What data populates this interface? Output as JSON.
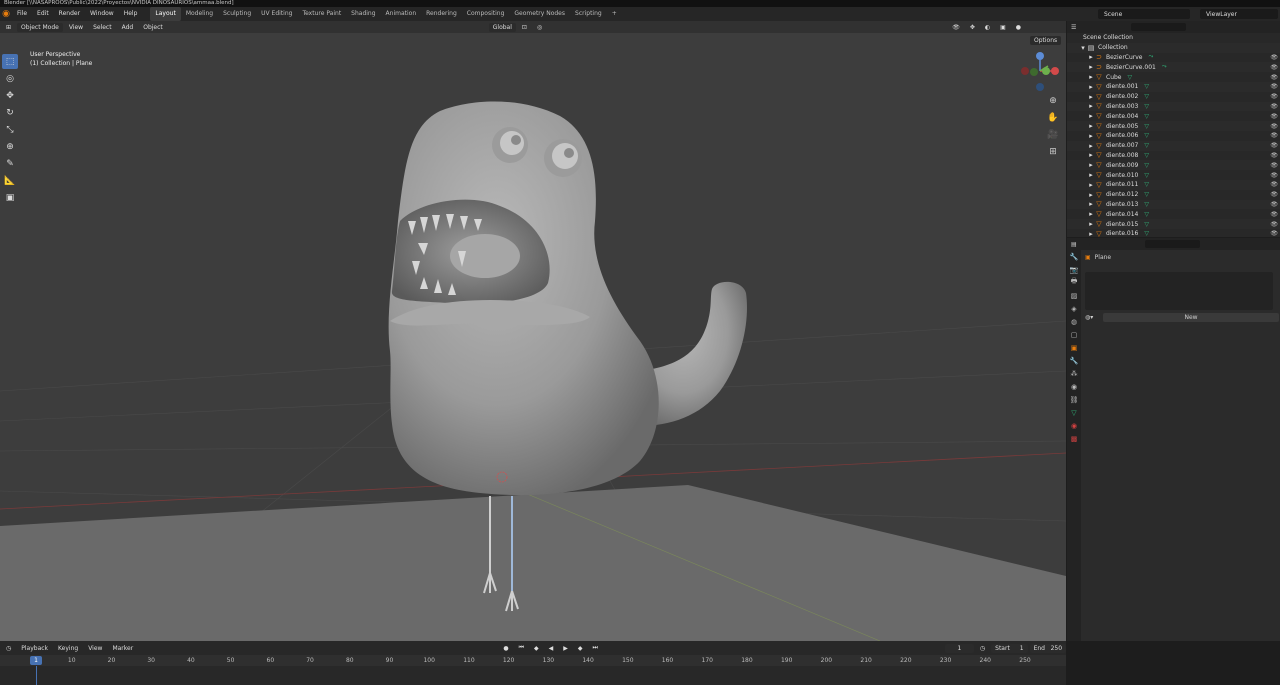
{
  "title_bar": {
    "text": "Blender [\\\\NASAPROOS\\Public\\2022\\Proyectos\\NVIDIA DINOSAURIOS\\ammaa.blend]"
  },
  "menu": [
    "File",
    "Edit",
    "Render",
    "Window",
    "Help"
  ],
  "workspaces": [
    "Layout",
    "Modeling",
    "Sculpting",
    "UV Editing",
    "Texture Paint",
    "Shading",
    "Animation",
    "Rendering",
    "Compositing",
    "Geometry Nodes",
    "Scripting"
  ],
  "workspace_add": "+",
  "scene": "Scene",
  "view_layer": "ViewLayer",
  "viewport": {
    "mode": "Object Mode",
    "menus": [
      "View",
      "Select",
      "Add",
      "Object"
    ],
    "orientation": "Global",
    "info_line1": "User Perspective",
    "info_line2": "(1) Collection | Plane",
    "options": "Options"
  },
  "outliner": {
    "root": "Scene Collection",
    "collection": "Collection",
    "items": [
      "BezierCurve",
      "BezierCurve.001",
      "Cube",
      "diente.001",
      "diente.002",
      "diente.003",
      "diente.004",
      "diente.005",
      "diente.006",
      "diente.007",
      "diente.008",
      "diente.009",
      "diente.010",
      "diente.011",
      "diente.012",
      "diente.013",
      "diente.014",
      "diente.015",
      "diente.016"
    ]
  },
  "properties": {
    "object": "Plane",
    "new_button": "New"
  },
  "timeline": {
    "menus": [
      "Playback",
      "Keying",
      "View",
      "Marker"
    ],
    "current_frame": "1",
    "start_label": "Start",
    "start": "1",
    "end_label": "End",
    "end": "250",
    "ticks": [
      "1",
      "10",
      "20",
      "30",
      "40",
      "50",
      "60",
      "70",
      "80",
      "90",
      "100",
      "110",
      "120",
      "130",
      "140",
      "150",
      "160",
      "170",
      "180",
      "190",
      "200",
      "210",
      "220",
      "230",
      "240",
      "250"
    ]
  },
  "colors": {
    "accent": "#4772b3",
    "orange": "#e87d0d",
    "mesh_green": "#2fb47a"
  }
}
